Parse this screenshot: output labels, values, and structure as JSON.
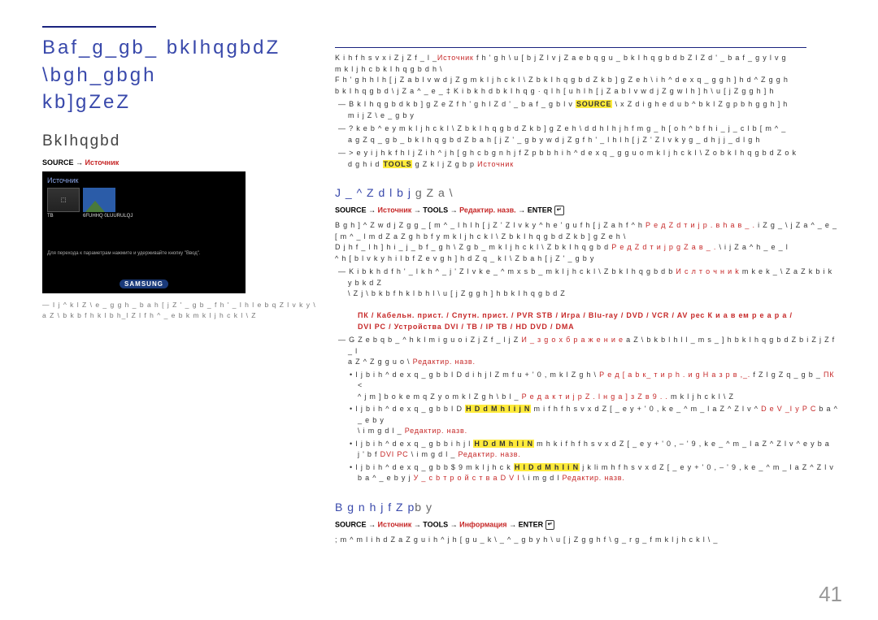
{
  "left": {
    "main_title_l1": "Baf_g_gb_ bkIhqgbdZ \\bgh_gbgh",
    "main_title_l2": "kb]gZeZ",
    "section": "BkIhqgbd",
    "path_source": "SOURCE",
    "path_arrow": " → ",
    "path_src_ru": "Источник",
    "shot_title": "Источник",
    "shot_sm1": "6FUHHQ 0LUURULQJ",
    "shot_cap1": "Для перехода к параметрам нажмите и удерживайте кнопку \"Ввод\".",
    "shot_brand": "SAMSUNG",
    "note": "― I j ^ k l Z \\ e _ g g h _  b a h [ j Z ' _ g b _  f h ' _ l  h l e b q Z l v k y  \\  a Z \\ b k b f h k l b  h_l  Z l  f h ^ _ e b  k  m k l j h c k l \\ Z"
  },
  "right": {
    "intro_l1a": "K  i h f h s v x  i Z j Z f _ l _",
    "intro_l1b": "Источник",
    "intro_l1c": "  f h ' g h  \\ u [ b j Z l v  j Z a e b q g u _  b k I h q g b d b  Z  l Z d ' _  b a f _ g y l v  g\n m k l j h c b k I h q g b d h \\",
    "intro_l2": "F h ' g h  h l h [ j Z a b l v  w d j Z g  m k l j h c k l \\ Z  b k I h q g b d Z  k b ] g Z e h \\  i h ^ d e x q _ g g h ] h  d  ^ Z g g h",
    "intro_l3": "b k I h q g b d  \\  j Z a ^ _ e _  ‡ K i b k h d  b k I h q g  ·  q l h [ u  h l h [ j Z a b l v  w d j Z g  w l h ] h  \\ u [ j Z g g h ] h",
    "b1a": "―  B k I h q g b d  k b ] g Z e Z  f h ' g h  l Z d ' _  b a f _ g b l v  ",
    "b1b": "SOURCE",
    "b1c": "  \\ x Z  d i g h e d u b  ",
    "b1d": "  ^ b k l Z g p b h g g h ] h\n     m i j Z \\ e _ g b y",
    "b2": "―  ? k e b  ^ e y  m k l j h c k l \\ Z  b k I h q g b d Z  k b ] g Z e h \\  d  d h l h j h f m  g _ h [ o h ^ b f h  i _ j _ c l b  [ m ^ _\n     a g Z q _ g b _  b k I h q g b d Z  b a h [ j Z ' _ g b y  w d j Z g  f h ' _ l  h l h [ j Z ' Z l v k y  g _ d h j j _ d l g h",
    "b3a": "― > e y  i j h k f h l j Z  i h ^ j h [ g h c  b g n h j f Z p b b  h  i h ^ d e x q _ g g u o  m k l j h c k l \\ Z o  b k I h q g b d Z o  k\n    d g h i d ",
    "b3b": "TOOLS",
    "b3c": " g Z  k l j Z g b p  ",
    "b3d": "Источник",
    "sec1_title": "J _ ^ Z d l b j",
    "sec1_title_sub": "  g Z a \\",
    "sec1_path_1": "SOURCE",
    "sec1_path_2": "Источник",
    "sec1_path_3": "TOOLS",
    "sec1_path_4": "Редактир. назв.",
    "sec1_path_5": "ENTER",
    "sec1_t1a": "B g h ] ^ Z  w d j Z g  g _  [ m ^ _ l  h l h [ j Z ' Z l v k y  ^ h e ' g u f  h [ j Z a h f  ^ h  ",
    "sec1_t1b": "Р е д Z d т и j р .  в h a в _ .",
    "sec1_t1c": " i Z g _  \\  j Z a ^ _ e _",
    "sec1_t2": "[ m ^ _ l  m d Z a Z g h  b f y  m k l j h c k l \\ Z  b k I h q g b d Z  k b ] g Z e h \\",
    "sec1_t3a": "D j h f _  l h ] h  i _ j _ b f _ g h \\ Z g b _  m k l j h c k l \\ Z  b k I h q g b d ",
    "sec1_t3b": "Р е д Z d т и j р  g Z a в _ .",
    "sec1_t3c": " \\  i j Z a ^ h _ e _ l",
    "sec1_t4": "^ h [ b l v k y  h i l b f Z e v g h ] h  d Z q _ k l \\ Z  b a h [ j Z ' _ g b y",
    "dash1a": "― K i b k h d  f h ' _ l  k h ^ _ j ' Z l v  k e _ ^ m x s b _  m k l j h c k l \\ Z  b k I h q g b d b ",
    "dash1b": "И с л т о ч н и k",
    "dash1c": "  m k e k _  \\  Z a  Z k b i k y b k d Z\n      \\ Z j \\ b k b f h k l b  h l  \\ u [ j Z g g h ] h  b k I h q g b d Z",
    "devices": "ПК  /  Кабельн. прист. / Спутн. прист.  /  PVR STB  /  Игра  /  Blu-ray  /  DVD  /  VCR  /  AV рес К и а в ем р е а р а  /\nDVI PC  /  Устройства DVI  /  ТВ  /  IP TВ / HD DVD  /  DMA",
    "dash2a": "―  G Z e b q b _  ^ h k l m i g u o  i Z j Z f _ l j Z ",
    "dash2b": "И _ з g о х б р а ж е н и е",
    "dash2c": "  a Z \\ b k b l  h l  l _ m s _ ] h  b k I h q g b d Z  b  i Z j Z f _ l\n     a Z ^ Z g g u o  \\  ",
    "dash2d": "Редактир. назв.",
    "dot1a": "•  I j b  i h ^ d e x q _ g b b  I D  d  i h j l Z m f u  + ' 0 ,  m k l Z g h \\ ",
    "dot1b": "Р е д [ а b к_ т и р h .  и g H а з p в ,_.",
    "dot1c": " f Z l g Z q _ g b _  ",
    "dot1d": "ПК",
    "dot1e": " <\n     ^ j m ] b o  k e m q Z y o  m k l Z g h \\ b l _  ",
    "dot1f": "Р е д а к т и j р Z .  l н g а ] з Z в 9 .  .",
    "dot1g": " m k l j h c k l \\ Z",
    "dot2a": "•  I j b  i h ^ d e x q _ g b b  I D  ",
    "dot2b": "H D d M h I i j N",
    "dot2c": " m  i f h f h s v x  d Z [ _ e y  + ' 0 ,  k e _ ^ m _ l  a Z ^ Z l v  ^ ",
    "dot2d": "D e V _I y P C",
    "dot2e": " b a ^ _ e b y\n     \\  i m g d l _  ",
    "dot2f": "Редактир. назв.",
    "dot3a": "•  I j b  i h ^ d e x q _ g b b  i h j l ",
    "dot3b": "H D d M h I i N",
    "dot3c": " m h k  i f h f h s v x  d Z [ _ e y  + ' 0 , – ' 9 ,  k e _ ^ m _ l  a Z ^ Z l v  ^ e y  b a\n     j ' b f  ",
    "dot3d": "DVI PC",
    "dot3e": "  \\  i m g d l _  ",
    "dot3f": "Редактир. назв.",
    "dot4a": "•  I j b  i h ^ d e x q _ g b b  $ 9  m k l j h c k ",
    "dot4b": "H l D d M h I i N",
    "dot4c": " j k  li m h f h s v x  d Z [ _ e y  + ' 0 , – ' 9 ,  k e _ ^ m _ l  a Z ^ Z l v\n     b a ^ _ e b y  j ",
    "dot4d": "У _ с b т р о й с т в а  D V I",
    "dot4e": "  \\  i m g d l  ",
    "dot4f": "Редактир. назв.",
    "sec2_title_a": "B g n h j f Z p",
    "sec2_title_b": "b y",
    "sec2_path_1": "SOURCE",
    "sec2_path_2": "Источник",
    "sec2_path_3": "TOOLS",
    "sec2_path_4": "Информация",
    "sec2_path_5": "ENTER",
    "sec2_txt": "; m ^ m l  i h d Z a Z g u  i h ^ j h [ g u _  k \\ _ ^ _ g b y  h  \\ u [ j Z g g h f  \\ g _ r g _ f  m k l j h c k l \\ _"
  },
  "page": "41"
}
